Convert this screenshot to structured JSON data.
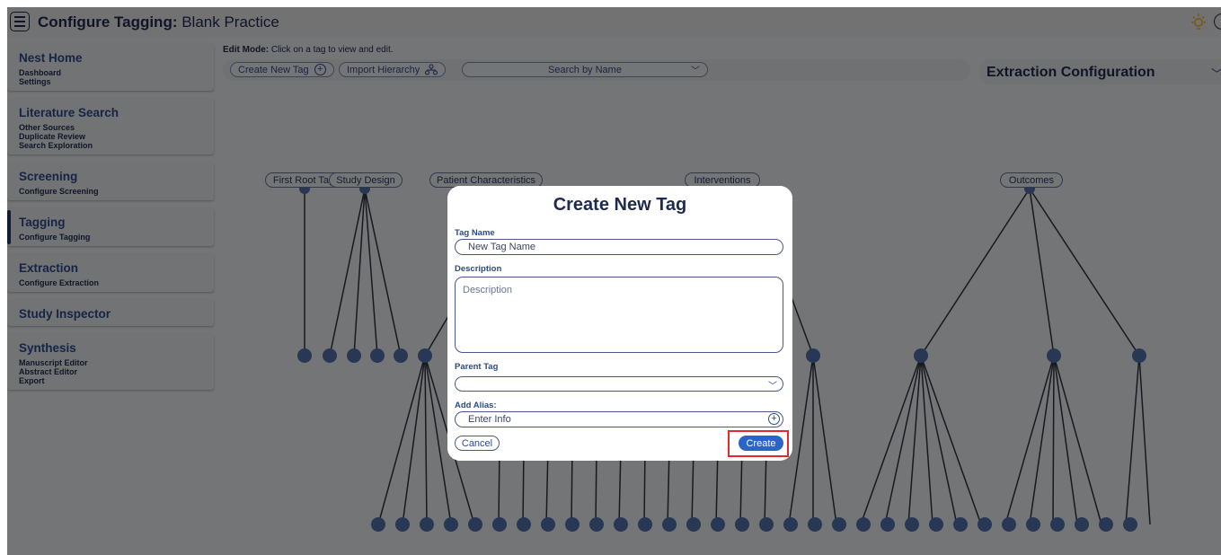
{
  "header": {
    "title_bold": "Configure Tagging:",
    "title_rest": " Blank Practice"
  },
  "sidebar": [
    {
      "title": "Nest Home",
      "items": [
        "Dashboard",
        "Settings"
      ]
    },
    {
      "title": "Literature Search",
      "items": [
        "Other Sources",
        "Duplicate Review",
        "Search Exploration"
      ]
    },
    {
      "title": "Screening",
      "items": [
        "Configure Screening"
      ]
    },
    {
      "title": "Tagging",
      "items": [
        "Configure Tagging"
      ],
      "active": true
    },
    {
      "title": "Extraction",
      "items": [
        "Configure Extraction"
      ]
    },
    {
      "title": "Study Inspector",
      "items": []
    },
    {
      "title": "Synthesis",
      "items": [
        "Manuscript Editor",
        "Abstract Editor",
        "Export"
      ]
    }
  ],
  "main": {
    "edit_mode_label": "Edit Mode:",
    "edit_mode_text": " Click on a tag to view and edit.",
    "toolbar": {
      "create_label": "Create New Tag",
      "import_label": "Import Hierarchy",
      "search_label": "Search by Name"
    },
    "extraction_title": "Extraction Configuration"
  },
  "tree_roots": [
    "First Root Tag",
    "Study Design",
    "Patient Characteristics",
    "Interventions",
    "Outcomes"
  ],
  "modal": {
    "title": "Create New Tag",
    "tag_name_label": "Tag Name",
    "tag_name_placeholder": "New Tag Name",
    "description_label": "Description",
    "description_placeholder": "Description",
    "parent_label": "Parent Tag",
    "parent_value": "",
    "alias_label": "Add Alias:",
    "alias_placeholder": "Enter Info",
    "cancel_label": "Cancel",
    "create_label": "Create"
  },
  "colors": {
    "node": "#4f6fa8",
    "accent": "#2c63c9",
    "highlight": "#e5282c",
    "overlay": "rgba(0,0,0,0.5)"
  }
}
